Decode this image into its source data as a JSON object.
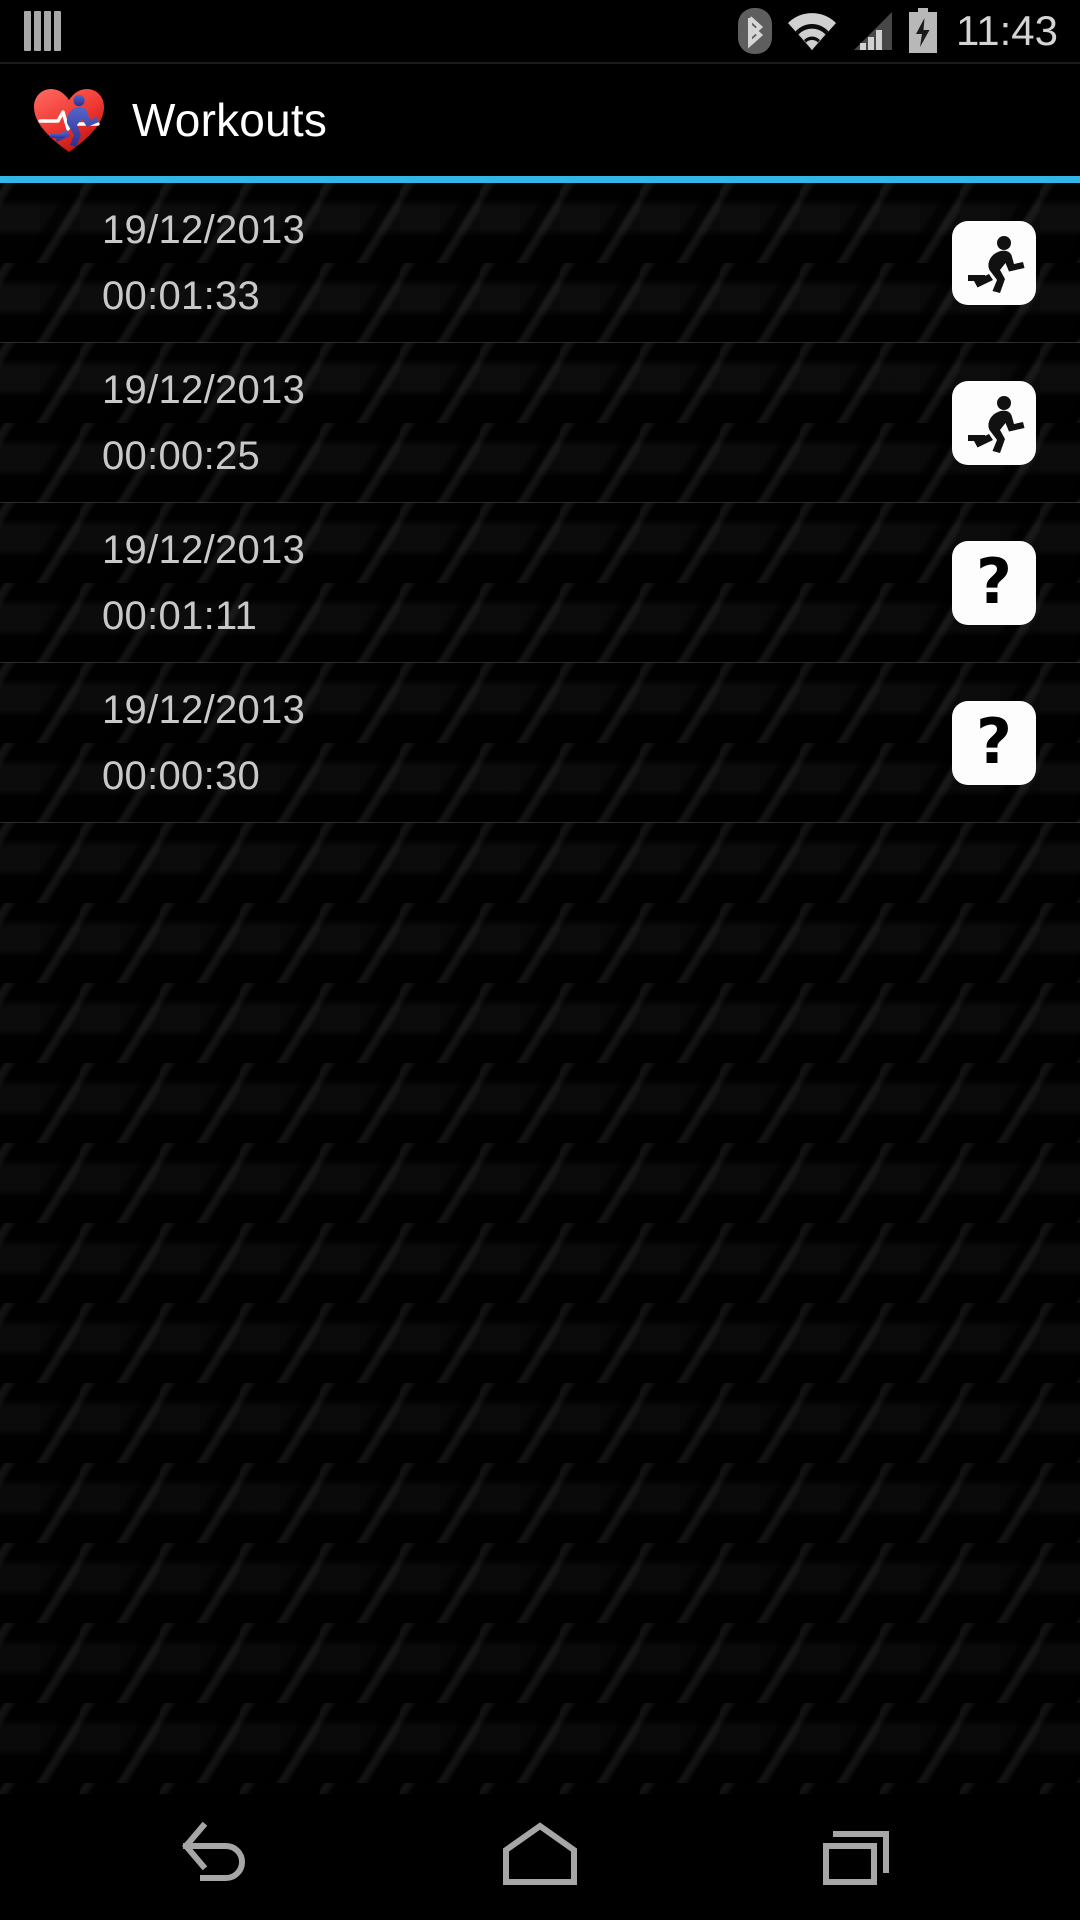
{
  "status_bar": {
    "notification_icon": "bars-notification-icon",
    "icons": [
      "bluetooth-icon",
      "wifi-icon",
      "cellular-signal-icon",
      "battery-charging-icon"
    ],
    "clock": "11:43"
  },
  "action_bar": {
    "app_icon": "heart-runner-icon",
    "title": "Workouts",
    "accent_color": "#33b5e5"
  },
  "list": {
    "rows": [
      {
        "date": "19/12/2013",
        "duration": "00:01:33",
        "icon": "running-person-icon",
        "icon_glyph": ""
      },
      {
        "date": "19/12/2013",
        "duration": "00:00:25",
        "icon": "running-person-icon",
        "icon_glyph": ""
      },
      {
        "date": "19/12/2013",
        "duration": "00:01:11",
        "icon": "question-mark-icon",
        "icon_glyph": "?"
      },
      {
        "date": "19/12/2013",
        "duration": "00:00:30",
        "icon": "question-mark-icon",
        "icon_glyph": "?"
      }
    ]
  },
  "nav_bar": {
    "back": "back-icon",
    "home": "home-icon",
    "recents": "recents-icon"
  },
  "colors": {
    "accent": "#33b5e5",
    "text_primary": "#ffffff",
    "text_secondary": "#c9c9c9",
    "background": "#000000"
  }
}
